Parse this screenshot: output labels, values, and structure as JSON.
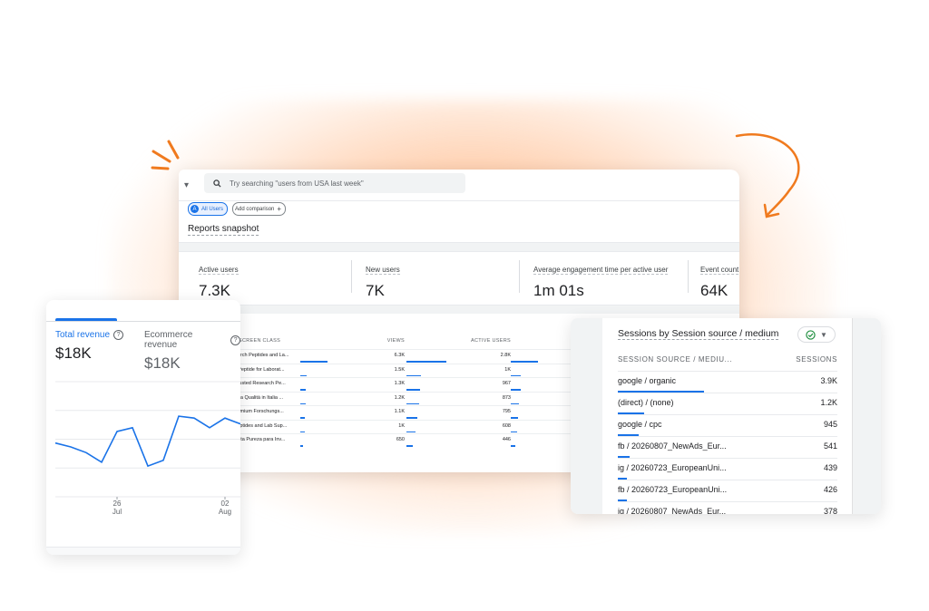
{
  "search": {
    "placeholder": "Try searching \"users from USA last week\""
  },
  "chips": {
    "all_users": "All Users",
    "all_users_avatar": "A",
    "add_comparison": "Add comparison"
  },
  "snapshot_title": "Reports snapshot",
  "metrics": [
    {
      "label": "Active users",
      "value": "7.3K"
    },
    {
      "label": "New users",
      "value": "7K"
    },
    {
      "label": "Average engagement time per active user",
      "value": "1m 01s"
    },
    {
      "label": "Event count",
      "value": "64K"
    }
  ],
  "pages_table": {
    "title_fragment": "ns",
    "headers": [
      "SCREEN CLASS",
      "VIEWS",
      "ACTIVE USERS"
    ],
    "rows": [
      {
        "name": "esearch Peptides and La...",
        "views": "6.3K",
        "users": "2.8K",
        "views_frac": 1.0,
        "users_frac": 1.0
      },
      {
        "name": "rch Peptide for Laborat...",
        "views": "1.5K",
        "users": "1K",
        "views_frac": 0.24,
        "users_frac": 0.36
      },
      {
        "name": "ly Trusted Research Pe...",
        "views": "1.3K",
        "users": "967",
        "views_frac": 0.21,
        "users_frac": 0.35
      },
      {
        "name": "di Alta Qualità in Italia ...",
        "views": "1.2K",
        "users": "873",
        "views_frac": 0.19,
        "users_frac": 0.31
      },
      {
        "name": "| Premium Forschungs...",
        "views": "1.1K",
        "users": "795",
        "views_frac": 0.17,
        "users_frac": 0.28
      },
      {
        "name": "n Peptides and Lab Sup...",
        "views": "1K",
        "users": "608",
        "views_frac": 0.16,
        "users_frac": 0.22
      },
      {
        "name": "de Alta Pureza para Inv...",
        "views": "650",
        "users": "446",
        "views_frac": 0.1,
        "users_frac": 0.16
      }
    ]
  },
  "revenue": {
    "tabs": [
      {
        "label": "Total revenue",
        "value": "$18K"
      },
      {
        "label": "Ecommerce revenue",
        "value": "$18K"
      }
    ],
    "help_icon": "?",
    "x_ticks": [
      {
        "day": "26",
        "month": "Jul"
      },
      {
        "day": "02",
        "month": "Aug"
      }
    ],
    "series": [
      28,
      26,
      23,
      18,
      34,
      36,
      16,
      19,
      42,
      41,
      36,
      41,
      38
    ]
  },
  "sessions": {
    "title": "Sessions by Session source / medium",
    "headers": [
      "SESSION SOURCE / MEDIU...",
      "SESSIONS"
    ],
    "rows": [
      {
        "source": "google / organic",
        "value": "3.9K",
        "frac": 1.0
      },
      {
        "source": "(direct) / (none)",
        "value": "1.2K",
        "frac": 0.31
      },
      {
        "source": "google / cpc",
        "value": "945",
        "frac": 0.24
      },
      {
        "source": "fb / 20260807_NewAds_Eur...",
        "value": "541",
        "frac": 0.14
      },
      {
        "source": "ig / 20260723_EuropeanUni...",
        "value": "439",
        "frac": 0.11
      },
      {
        "source": "fb / 20260723_EuropeanUni...",
        "value": "426",
        "frac": 0.11
      },
      {
        "source": "ig / 20260807_NewAds_Eur...",
        "value": "378",
        "frac": 0.1
      }
    ]
  },
  "colors": {
    "accent": "#1a73e8",
    "glow": "#ff9a55",
    "decoration": "#f07a1e",
    "check": "#1e8e3e"
  }
}
